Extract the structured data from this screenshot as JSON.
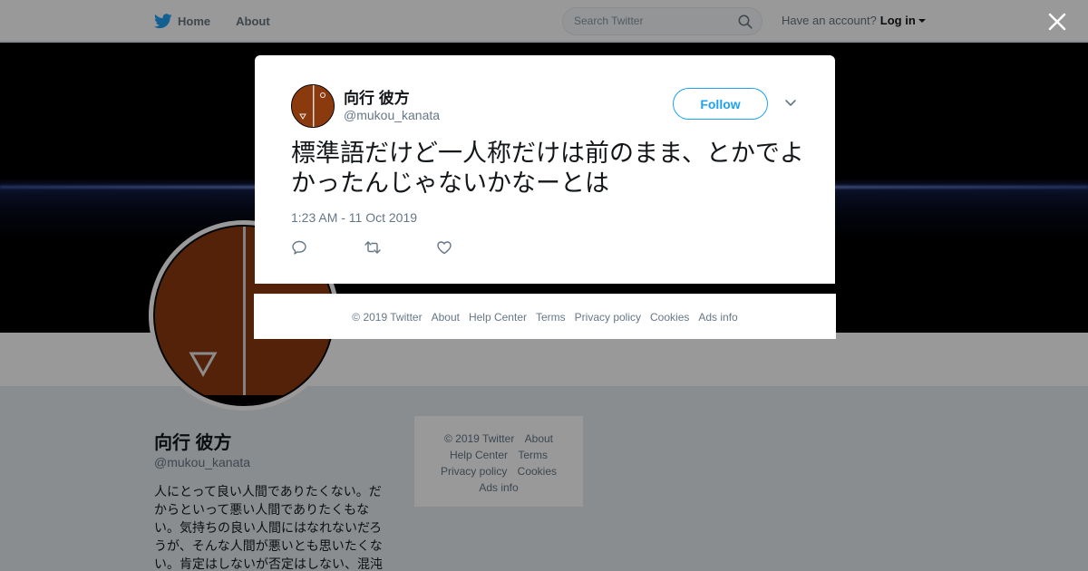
{
  "topnav": {
    "home_label": "Home",
    "about_label": "About",
    "search_placeholder": "Search Twitter",
    "account_prompt": "Have an account?",
    "login_label": "Log in",
    "brand_color": "#1da1f2"
  },
  "profile": {
    "name": "向行 彼方",
    "handle": "@mukou_kanata",
    "bio": "人にとって良い人間でありたくない。だからといって悪い人間でありたくもない。気持ちの良い人間にはなれないだろうが、そんな人間が悪いとも思いたくない。肯定はしないが否定はしない、混沌"
  },
  "side_footer": {
    "copyright": "© 2019 Twitter",
    "about": "About",
    "help": "Help Center",
    "terms": "Terms",
    "privacy": "Privacy policy",
    "cookies": "Cookies",
    "ads": "Ads info"
  },
  "tweet": {
    "author_name": "向行 彼方",
    "author_handle": "@mukou_kanata",
    "follow_label": "Follow",
    "text": "標準語だけど一人称だけは前のまま、とかでよかったんじゃないかなーとは",
    "timestamp": "1:23 AM - 11 Oct 2019",
    "icons": [
      "reply-icon",
      "retweet-icon",
      "like-icon"
    ]
  },
  "modal_footer": {
    "copyright": "© 2019 Twitter",
    "about": "About",
    "help": "Help Center",
    "terms": "Terms",
    "privacy": "Privacy policy",
    "cookies": "Cookies",
    "ads": "Ads info"
  }
}
